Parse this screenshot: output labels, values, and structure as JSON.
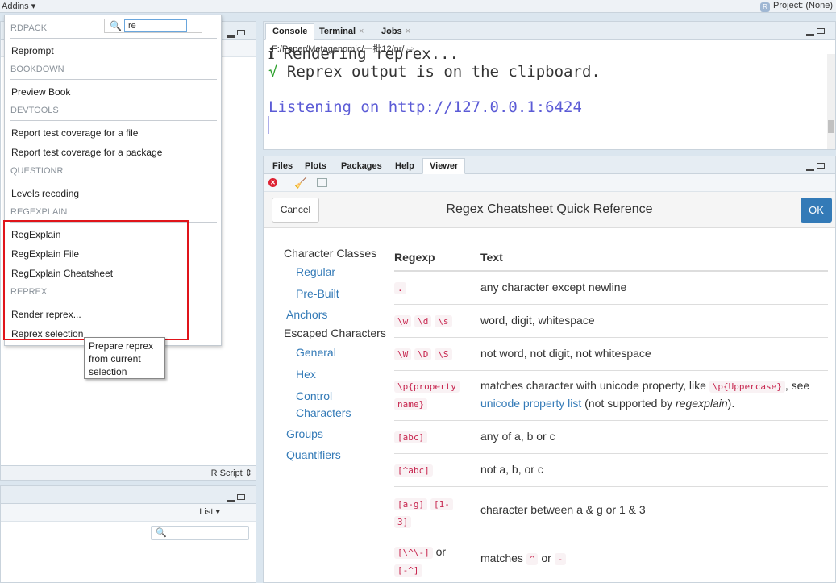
{
  "topbar": {
    "addins": "Addins",
    "project": "Project: (None)"
  },
  "menu": {
    "search_value": "re",
    "sections": {
      "rdpack": "RDPACK",
      "bookdown": "BOOKDOWN",
      "devtools": "DEVTOOLS",
      "questionr": "QUESTIONR",
      "regexplain": "REGEXPLAIN",
      "reprex": "REPREX"
    },
    "items": {
      "reprompt": "Reprompt",
      "preview_book": "Preview Book",
      "coverage_file": "Report test coverage for a file",
      "coverage_package": "Report test coverage for a package",
      "levels_recoding": "Levels recoding",
      "regexplain": "RegExplain",
      "regexplain_file": "RegExplain File",
      "regexplain_cheatsheet": "RegExplain Cheatsheet",
      "render_reprex": "Render reprex...",
      "reprex_selection": "Reprex selection"
    },
    "tooltip": "Prepare reprex from current selection"
  },
  "source": {
    "footer": "R Script ⇕"
  },
  "env": {
    "list": "List ▾"
  },
  "console": {
    "tabs": [
      "Console",
      "Terminal",
      "Jobs"
    ],
    "path": "F:/Paper/Metagenomic/一批12/nr/",
    "lines": {
      "l1": "ℹ Rendering reprex...",
      "l2_mark": "√",
      "l2": " Reprex output is on the clipboard.",
      "l3": "Listening on http://127.0.0.1:6424"
    },
    "colors": {
      "info": "#222222",
      "check": "#2ca02c",
      "listening": "#5b5bd6"
    }
  },
  "viewer": {
    "tabs": [
      "Files",
      "Plots",
      "Packages",
      "Help",
      "Viewer"
    ],
    "cancel": "Cancel",
    "title": "Regex Cheatsheet Quick Reference",
    "ok": "OK",
    "toc": {
      "character_classes": "Character Classes",
      "regular": "Regular",
      "pre_built": "Pre-Built",
      "anchors": "Anchors",
      "escaped_characters": "Escaped Characters",
      "general": "General",
      "hex": "Hex",
      "control": "Control",
      "characters": "Characters",
      "groups": "Groups",
      "quantifiers": "Quantifiers"
    },
    "table": {
      "col_regexp": "Regexp",
      "col_text": "Text",
      "rows": {
        "r1": {
          "code": ".",
          "text": "any character except newline"
        },
        "r2": {
          "code1": "\\w",
          "code2": "\\d",
          "code3": "\\s",
          "text": "word, digit, whitespace"
        },
        "r3": {
          "code1": "\\W",
          "code2": "\\D",
          "code3": "\\S",
          "text": "not word, not digit, not whitespace"
        },
        "r4": {
          "code_a": "\\p{property",
          "code_b": "name}",
          "text1": "matches character with unicode property, like ",
          "code_inline": "\\p{Uppercase}",
          "text2": ", see ",
          "link": "unicode property list",
          "text3": " (not supported by ",
          "em": "regexplain",
          "text4": ")."
        },
        "r5": {
          "code": "[abc]",
          "text": "any of a, b or c"
        },
        "r6": {
          "code": "[^abc]",
          "text": "not a, b, or c"
        },
        "r7": {
          "code1": "[a-g]",
          "code2a": "[1-",
          "code2b": "3]",
          "text": "character between a & g or 1 & 3"
        },
        "r8": {
          "code1": "[\\^\\-]",
          "or": "or",
          "code2": "[-^]",
          "text1": "matches ",
          "code_a": "^",
          "text2": " or ",
          "code_b": "-"
        }
      }
    }
  }
}
